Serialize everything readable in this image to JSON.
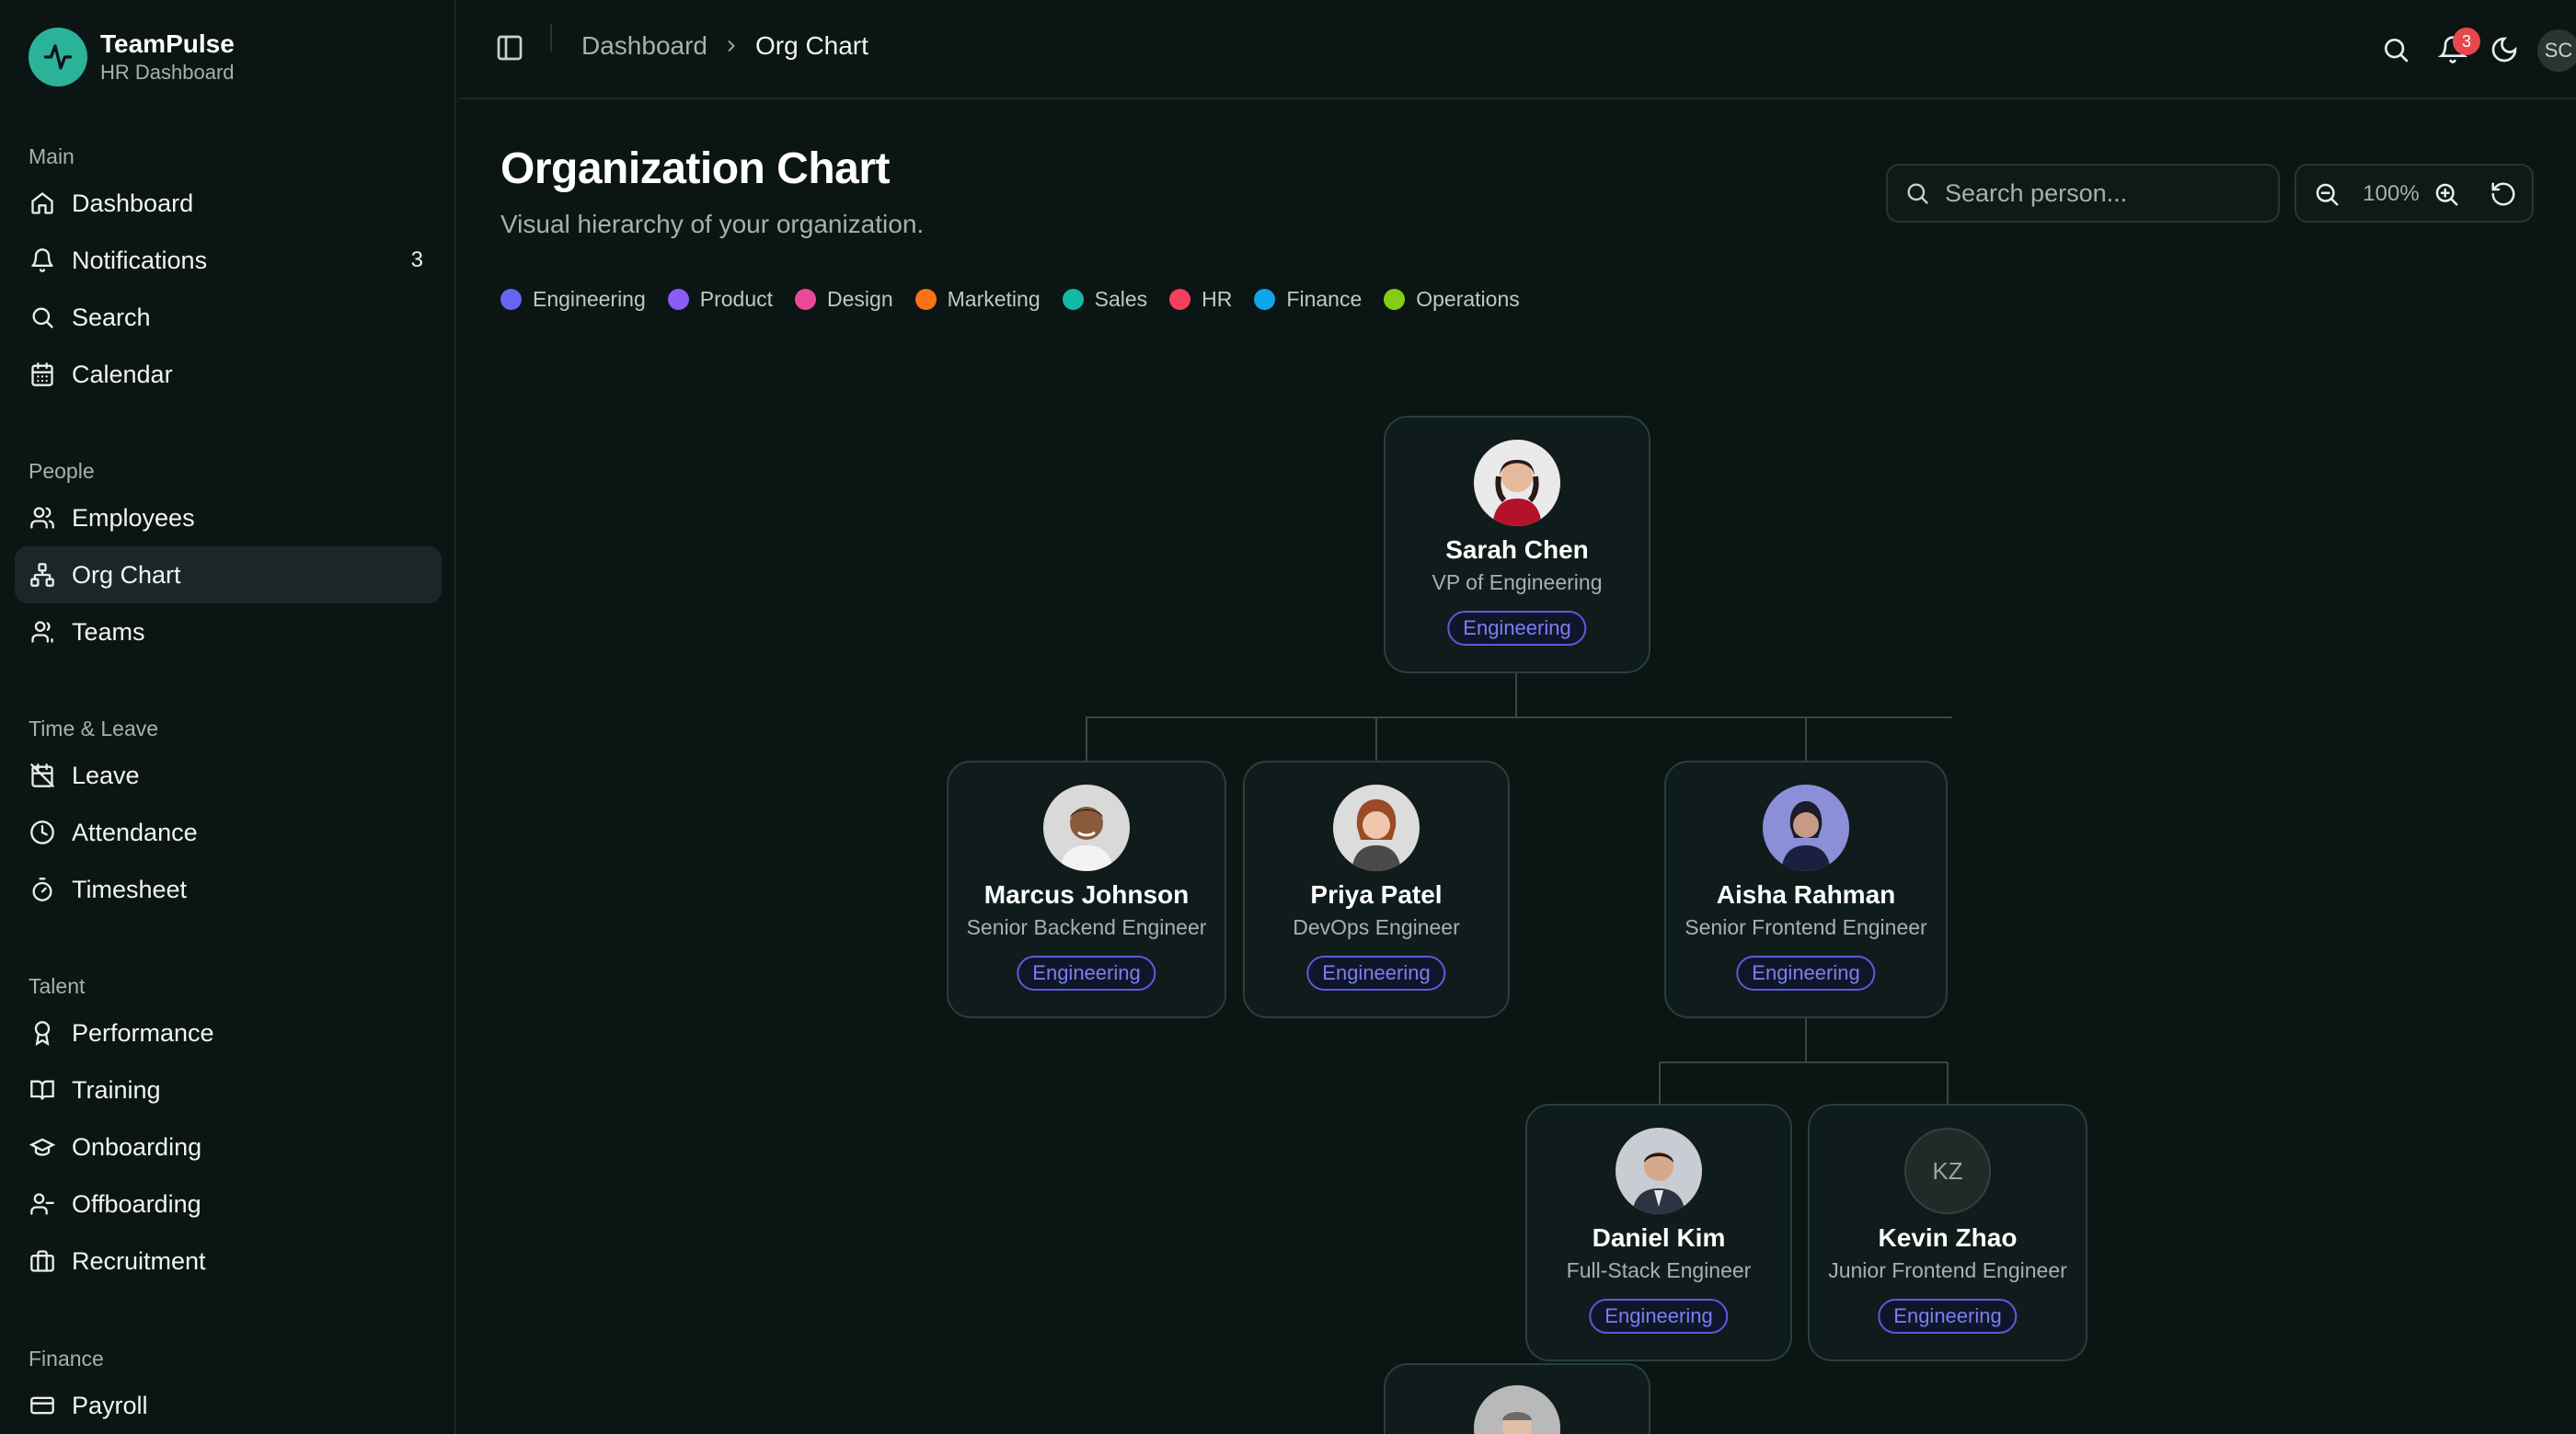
{
  "brand": {
    "name": "TeamPulse",
    "subtitle": "HR Dashboard"
  },
  "sidebar": {
    "sections": [
      {
        "title": "Main",
        "items": [
          {
            "label": "Dashboard",
            "icon": "home-icon"
          },
          {
            "label": "Notifications",
            "icon": "bell-icon",
            "count": "3"
          },
          {
            "label": "Search",
            "icon": "search-icon"
          },
          {
            "label": "Calendar",
            "icon": "calendar-icon"
          }
        ]
      },
      {
        "title": "People",
        "items": [
          {
            "label": "Employees",
            "icon": "users-icon"
          },
          {
            "label": "Org Chart",
            "icon": "org-chart-icon",
            "active": true
          },
          {
            "label": "Teams",
            "icon": "team-icon"
          }
        ]
      },
      {
        "title": "Time & Leave",
        "items": [
          {
            "label": "Leave",
            "icon": "calendar-off-icon"
          },
          {
            "label": "Attendance",
            "icon": "clock-icon"
          },
          {
            "label": "Timesheet",
            "icon": "timer-icon"
          }
        ]
      },
      {
        "title": "Talent",
        "items": [
          {
            "label": "Performance",
            "icon": "award-icon"
          },
          {
            "label": "Training",
            "icon": "book-icon"
          },
          {
            "label": "Onboarding",
            "icon": "graduation-cap-icon"
          },
          {
            "label": "Offboarding",
            "icon": "user-minus-icon"
          },
          {
            "label": "Recruitment",
            "icon": "briefcase-icon"
          }
        ]
      },
      {
        "title": "Finance",
        "items": [
          {
            "label": "Payroll",
            "icon": "credit-card-icon"
          }
        ]
      }
    ]
  },
  "header": {
    "breadcrumb": {
      "parent": "Dashboard",
      "current": "Org Chart"
    },
    "notification_count": "3",
    "user_initials": "SC"
  },
  "page": {
    "title": "Organization Chart",
    "subtitle": "Visual hierarchy of your organization.",
    "search_placeholder": "Search person...",
    "zoom": "100%"
  },
  "legend": [
    {
      "label": "Engineering",
      "color": "#6366f1"
    },
    {
      "label": "Product",
      "color": "#8b5cf6"
    },
    {
      "label": "Design",
      "color": "#ec4899"
    },
    {
      "label": "Marketing",
      "color": "#f97316"
    },
    {
      "label": "Sales",
      "color": "#14b8a6"
    },
    {
      "label": "HR",
      "color": "#f43f5e"
    },
    {
      "label": "Finance",
      "color": "#0ea5e9"
    },
    {
      "label": "Operations",
      "color": "#84cc16"
    }
  ],
  "people": {
    "sarah": {
      "name": "Sarah Chen",
      "role": "VP of Engineering",
      "dept": "Engineering"
    },
    "marcus": {
      "name": "Marcus Johnson",
      "role": "Senior Backend Engineer",
      "dept": "Engineering"
    },
    "priya": {
      "name": "Priya Patel",
      "role": "DevOps Engineer",
      "dept": "Engineering"
    },
    "aisha": {
      "name": "Aisha Rahman",
      "role": "Senior Frontend Engineer",
      "dept": "Engineering"
    },
    "daniel": {
      "name": "Daniel Kim",
      "role": "Full-Stack Engineer",
      "dept": "Engineering"
    },
    "kevin": {
      "name": "Kevin Zhao",
      "role": "Junior Frontend Engineer",
      "dept": "Engineering",
      "initials": "KZ"
    }
  }
}
